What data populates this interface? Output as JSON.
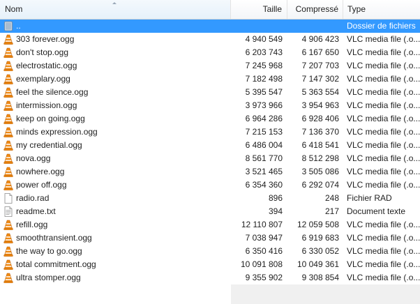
{
  "header": {
    "name_label": "Nom",
    "size_label": "Taille",
    "compressed_label": "Compressé",
    "type_label": "Type"
  },
  "files": [
    {
      "name": "..",
      "size": "",
      "compressed": "",
      "type": "Dossier de fichiers",
      "icon": "folder-up-icon",
      "selected": true
    },
    {
      "name": "303 forever.ogg",
      "size": "4 940 549",
      "compressed": "4 906 423",
      "type": "VLC media file (.o...",
      "icon": "vlc-icon"
    },
    {
      "name": "don't stop.ogg",
      "size": "6 203 743",
      "compressed": "6 167 650",
      "type": "VLC media file (.o...",
      "icon": "vlc-icon"
    },
    {
      "name": "electrostatic.ogg",
      "size": "7 245 968",
      "compressed": "7 207 703",
      "type": "VLC media file (.o...",
      "icon": "vlc-icon"
    },
    {
      "name": "exemplary.ogg",
      "size": "7 182 498",
      "compressed": "7 147 302",
      "type": "VLC media file (.o...",
      "icon": "vlc-icon"
    },
    {
      "name": "feel the silence.ogg",
      "size": "5 395 547",
      "compressed": "5 363 554",
      "type": "VLC media file (.o...",
      "icon": "vlc-icon"
    },
    {
      "name": "intermission.ogg",
      "size": "3 973 966",
      "compressed": "3 954 963",
      "type": "VLC media file (.o...",
      "icon": "vlc-icon"
    },
    {
      "name": "keep on going.ogg",
      "size": "6 964 286",
      "compressed": "6 928 406",
      "type": "VLC media file (.o...",
      "icon": "vlc-icon"
    },
    {
      "name": "minds expression.ogg",
      "size": "7 215 153",
      "compressed": "7 136 370",
      "type": "VLC media file (.o...",
      "icon": "vlc-icon"
    },
    {
      "name": "my credential.ogg",
      "size": "6 486 004",
      "compressed": "6 418 541",
      "type": "VLC media file (.o...",
      "icon": "vlc-icon"
    },
    {
      "name": "nova.ogg",
      "size": "8 561 770",
      "compressed": "8 512 298",
      "type": "VLC media file (.o...",
      "icon": "vlc-icon"
    },
    {
      "name": "nowhere.ogg",
      "size": "3 521 465",
      "compressed": "3 505 086",
      "type": "VLC media file (.o...",
      "icon": "vlc-icon"
    },
    {
      "name": "power off.ogg",
      "size": "6 354 360",
      "compressed": "6 292 074",
      "type": "VLC media file (.o...",
      "icon": "vlc-icon"
    },
    {
      "name": "radio.rad",
      "size": "896",
      "compressed": "248",
      "type": "Fichier RAD",
      "icon": "blank-file-icon"
    },
    {
      "name": "readme.txt",
      "size": "394",
      "compressed": "217",
      "type": "Document texte",
      "icon": "text-file-icon"
    },
    {
      "name": "refill.ogg",
      "size": "12 110 807",
      "compressed": "12 059 508",
      "type": "VLC media file (.o...",
      "icon": "vlc-icon"
    },
    {
      "name": "smoothtransient.ogg",
      "size": "7 038 947",
      "compressed": "6 919 683",
      "type": "VLC media file (.o...",
      "icon": "vlc-icon"
    },
    {
      "name": "the way to go.ogg",
      "size": "6 350 416",
      "compressed": "6 330 052",
      "type": "VLC media file (.o...",
      "icon": "vlc-icon"
    },
    {
      "name": "total commitment.ogg",
      "size": "10 091 808",
      "compressed": "10 049 361",
      "type": "VLC media file (.o...",
      "icon": "vlc-icon"
    },
    {
      "name": "ultra stomper.ogg",
      "size": "9 355 902",
      "compressed": "9 308 854",
      "type": "VLC media file (.o...",
      "icon": "vlc-icon"
    }
  ],
  "colors": {
    "selection": "#3399ff",
    "vlc_orange": "#f08a14"
  }
}
